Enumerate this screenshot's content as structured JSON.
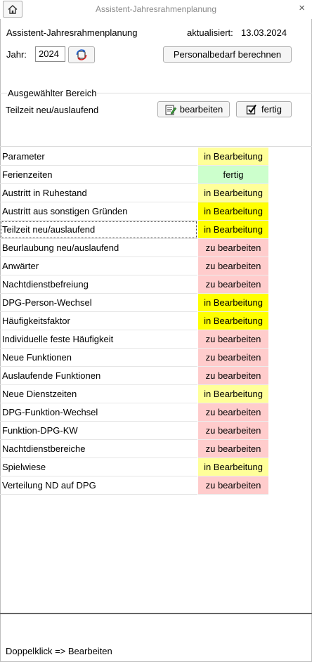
{
  "window": {
    "title": "Assistent-Jahresrahmenplanung",
    "close_glyph": "×"
  },
  "header": {
    "app_title": "Assistent-Jahresrahmenplanung",
    "updated_label": "aktualisiert:",
    "updated_date": "13.03.2024",
    "year_label": "Jahr:",
    "year_value": "2024",
    "calc_button": "Personalbedarf berechnen"
  },
  "section": {
    "group_title": "Ausgewählter Bereich",
    "selected_area": "Teilzeit neu/auslaufend",
    "edit_button": "bearbeiten",
    "done_button": "fertig"
  },
  "colors": {
    "in_progress_light": "#ffff99",
    "in_progress_strong": "#ffff00",
    "done": "#ccffcc",
    "todo": "#ffcccc"
  },
  "rows": [
    {
      "name": "Parameter",
      "status": "in Bearbeitung",
      "color": "#ffff99"
    },
    {
      "name": "Ferienzeiten",
      "status": "fertig",
      "color": "#ccffcc"
    },
    {
      "name": "Austritt in Ruhestand",
      "status": "in Bearbeitung",
      "color": "#ffff99"
    },
    {
      "name": "Austritt aus sonstigen Gründen",
      "status": "in Bearbeitung",
      "color": "#ffff00"
    },
    {
      "name": "Teilzeit neu/auslaufend",
      "status": "in Bearbeitung",
      "color": "#ffff00",
      "selected": true
    },
    {
      "name": "Beurlaubung neu/auslaufend",
      "status": "zu bearbeiten",
      "color": "#ffcccc"
    },
    {
      "name": "Anwärter",
      "status": "zu bearbeiten",
      "color": "#ffcccc"
    },
    {
      "name": "Nachtdienstbefreiung",
      "status": "zu bearbeiten",
      "color": "#ffcccc"
    },
    {
      "name": "DPG-Person-Wechsel",
      "status": "in Bearbeitung",
      "color": "#ffff00"
    },
    {
      "name": "Häufigkeitsfaktor",
      "status": "in Bearbeitung",
      "color": "#ffff00"
    },
    {
      "name": "Individuelle feste Häufigkeit",
      "status": "zu bearbeiten",
      "color": "#ffcccc"
    },
    {
      "name": "Neue Funktionen",
      "status": "zu bearbeiten",
      "color": "#ffcccc"
    },
    {
      "name": "Auslaufende Funktionen",
      "status": "zu bearbeiten",
      "color": "#ffcccc"
    },
    {
      "name": "Neue Dienstzeiten",
      "status": "in Bearbeitung",
      "color": "#ffff99"
    },
    {
      "name": "DPG-Funktion-Wechsel",
      "status": "zu bearbeiten",
      "color": "#ffcccc"
    },
    {
      "name": "Funktion-DPG-KW",
      "status": "zu bearbeiten",
      "color": "#ffcccc"
    },
    {
      "name": "Nachtdienstbereiche",
      "status": "zu bearbeiten",
      "color": "#ffcccc"
    },
    {
      "name": "Spielwiese",
      "status": "in Bearbeitung",
      "color": "#ffff99"
    },
    {
      "name": "Verteilung ND auf DPG",
      "status": "zu bearbeiten",
      "color": "#ffcccc"
    }
  ],
  "footer": {
    "hint": "Doppelklick => Bearbeiten"
  }
}
